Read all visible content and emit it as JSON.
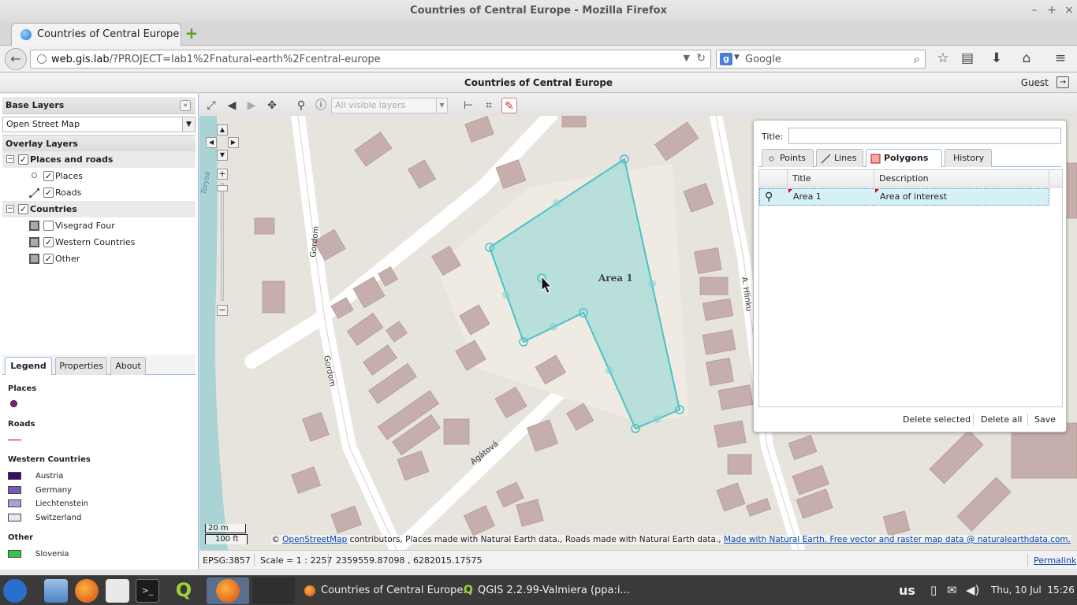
{
  "window": {
    "title": "Countries of Central Europe - Mozilla Firefox"
  },
  "browser": {
    "tab_title": "Countries of Central Europe",
    "url_host": "web.gis.lab",
    "url_path": "/?PROJECT=lab1%2Fnatural-earth%2Fcentral-europe",
    "search_engine": "Google",
    "search_placeholder": "Google"
  },
  "app": {
    "title": "Countries of Central Europe",
    "user": "Guest"
  },
  "base_layers": {
    "header": "Base Layers",
    "selected": "Open Street Map"
  },
  "overlay_layers": {
    "header": "Overlay Layers",
    "groups": [
      {
        "label": "Places and roads",
        "checked": true,
        "children": [
          {
            "label": "Places",
            "checked": true
          },
          {
            "label": "Roads",
            "checked": true
          }
        ]
      },
      {
        "label": "Countries",
        "checked": true,
        "children": [
          {
            "label": "Visegrad Four",
            "checked": false
          },
          {
            "label": "Western Countries",
            "checked": true
          },
          {
            "label": "Other",
            "checked": true
          }
        ]
      }
    ]
  },
  "panel_tabs": [
    "Legend",
    "Properties",
    "About"
  ],
  "legend": {
    "sections": [
      {
        "title": "Places",
        "items": []
      },
      {
        "title": "Roads",
        "items": []
      },
      {
        "title": "Western Countries",
        "items": [
          {
            "label": "Austria",
            "color": "#3b0a6e"
          },
          {
            "label": "Germany",
            "color": "#7a5ab8"
          },
          {
            "label": "Liechtenstein",
            "color": "#a8a0d8"
          },
          {
            "label": "Switzerland",
            "color": "#e8e6f4"
          }
        ]
      },
      {
        "title": "Other",
        "items": [
          {
            "label": "Slovenia",
            "color": "#3cc24a"
          }
        ]
      }
    ]
  },
  "map_toolbar": {
    "layer_filter": "All visible layers"
  },
  "map": {
    "area_label": "Area 1",
    "streets": [
      "Gordom",
      "Gordom",
      "Agátová",
      "A. Hlinku",
      "Torysa"
    ],
    "scale_bar": {
      "metric": "20 m",
      "imperial": "100 ft"
    },
    "attribution": {
      "prefix": "©",
      "osm_link": "OpenStreetMap",
      "text": "contributors, Places made with Natural Earth data., Roads made with Natural Earth data.,",
      "ne_link": "Made with Natural Earth. Free vector and raster map data @ naturalearthdata.com."
    }
  },
  "drawing_panel": {
    "title_label": "Title:",
    "title_value": "",
    "tabs": [
      "Points",
      "Lines",
      "Polygons",
      "History"
    ],
    "active_tab": "Polygons",
    "columns": [
      "Title",
      "Description"
    ],
    "rows": [
      {
        "title": "Area 1",
        "description": "Area of interest"
      }
    ],
    "buttons": {
      "delete_selected": "Delete selected",
      "delete_all": "Delete all",
      "save": "Save"
    }
  },
  "status": {
    "projection": "EPSG:3857",
    "scale": "Scale = 1 : 2257",
    "coords": "2359559.87098 , 6282015.17575",
    "permalink": "Permalink"
  },
  "taskbar": {
    "apps": [
      {
        "label": "Countries of Central Europe..."
      },
      {
        "label": "QGIS 2.2.99-Valmiera (ppa:i..."
      }
    ],
    "keyboard": "us",
    "clock": "Thu, 10 Jul  15:26"
  }
}
